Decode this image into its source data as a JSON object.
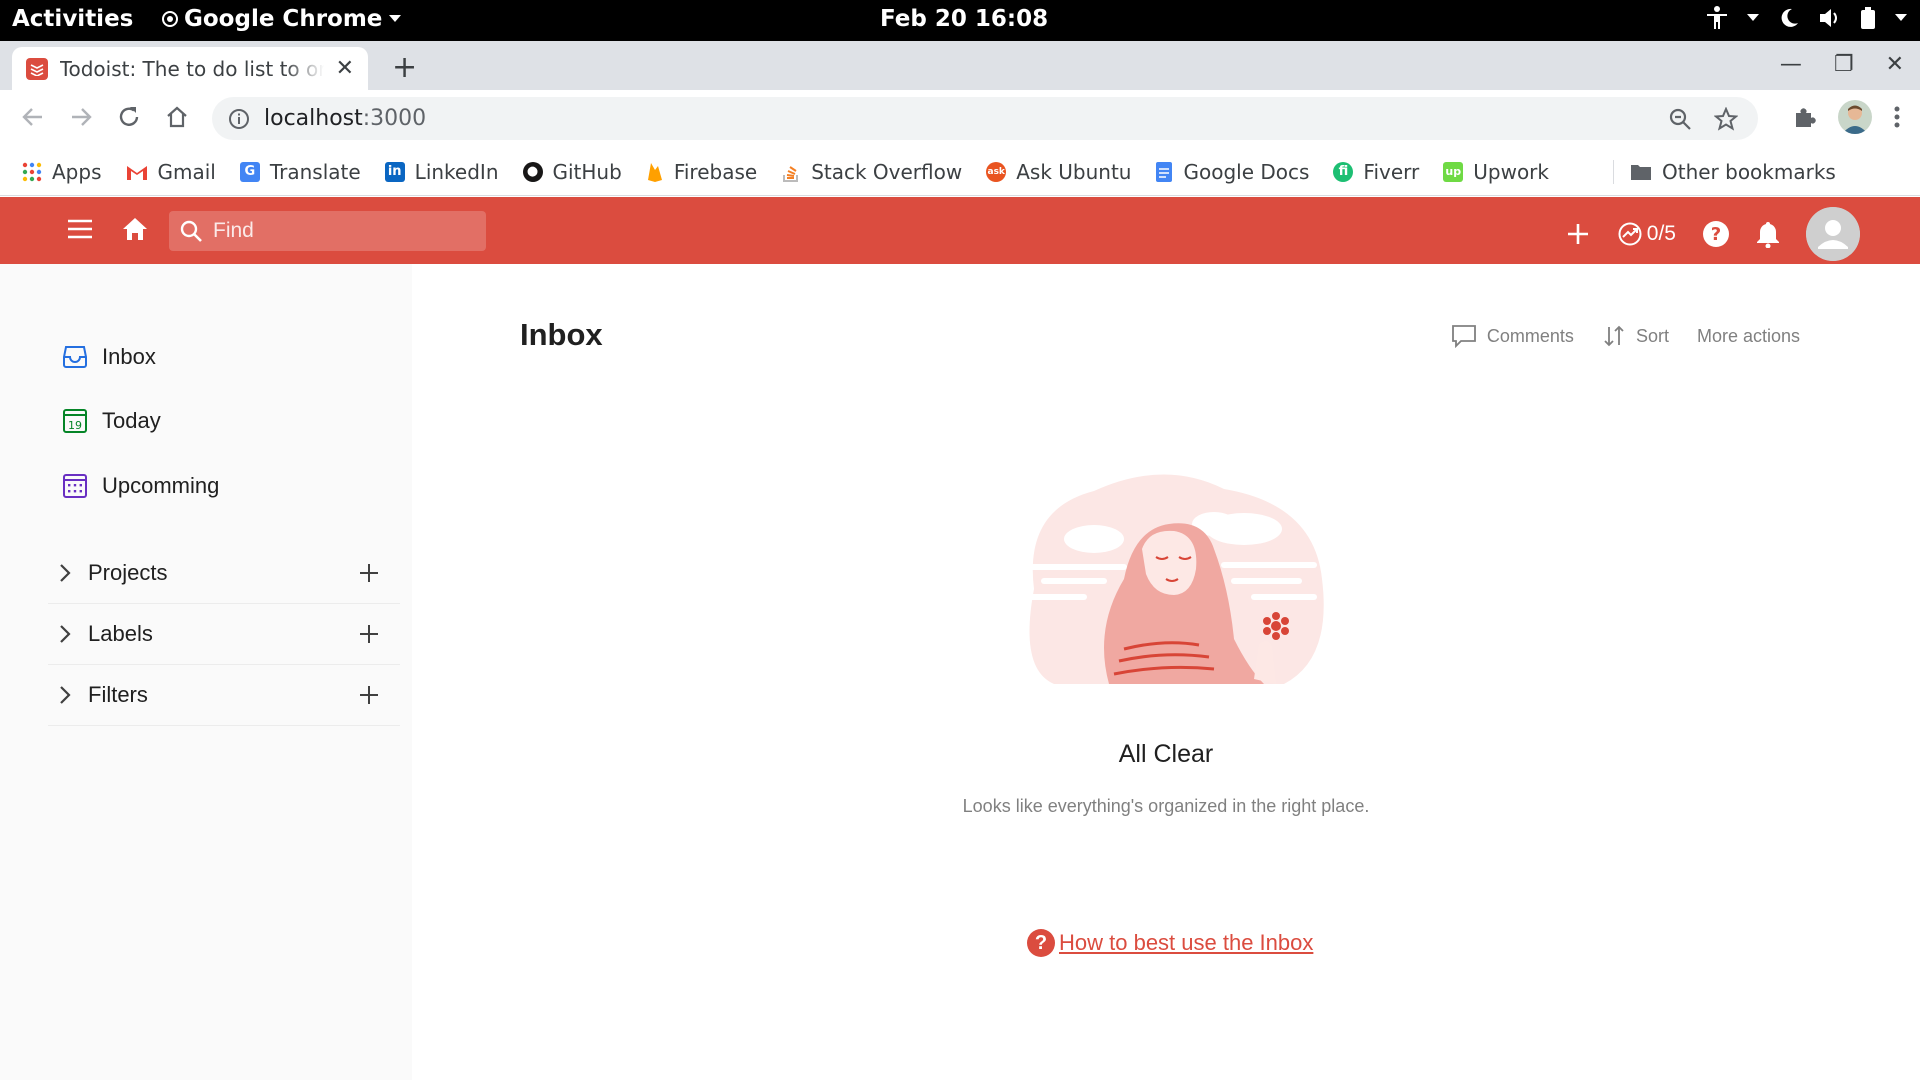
{
  "system_bar": {
    "activities": "Activities",
    "app_name": "Google Chrome",
    "datetime": "Feb 20  16:08"
  },
  "browser": {
    "tab_title": "Todoist: The to do list to organize work & life",
    "url_host": "localhost",
    "url_port": ":3000",
    "bookmarks": [
      {
        "label": "Apps",
        "icon": "apps-grid-icon",
        "color": "#ea4335"
      },
      {
        "label": "Gmail",
        "icon": "gmail-icon",
        "color": "#ea4335"
      },
      {
        "label": "Translate",
        "icon": "translate-icon",
        "color": "#4285f4"
      },
      {
        "label": "LinkedIn",
        "icon": "linkedin-icon",
        "color": "#0a66c2"
      },
      {
        "label": "GitHub",
        "icon": "github-icon",
        "color": "#181717"
      },
      {
        "label": "Firebase",
        "icon": "firebase-icon",
        "color": "#ffa000"
      },
      {
        "label": "Stack Overflow",
        "icon": "stackoverflow-icon",
        "color": "#f48024"
      },
      {
        "label": "Ask Ubuntu",
        "icon": "askubuntu-icon",
        "color": "#e95420"
      },
      {
        "label": "Google Docs",
        "icon": "google-docs-icon",
        "color": "#4285f4"
      },
      {
        "label": "Fiverr",
        "icon": "fiverr-icon",
        "color": "#1dbf73"
      },
      {
        "label": "Upwork",
        "icon": "upwork-icon",
        "color": "#6fda44"
      }
    ],
    "other_bookmarks": "Other bookmarks"
  },
  "header": {
    "search_placeholder": "Find",
    "karma": "0/5",
    "brand_color": "#db4c3f"
  },
  "sidebar": {
    "nav": [
      {
        "label": "Inbox",
        "icon": "inbox-icon",
        "color": "#246fe0"
      },
      {
        "label": "Today",
        "icon": "calendar-today-icon",
        "day": "19",
        "color": "#058527"
      },
      {
        "label": "Upcomming",
        "icon": "calendar-upcoming-icon",
        "color": "#692fc2"
      }
    ],
    "sections": [
      {
        "label": "Projects"
      },
      {
        "label": "Labels"
      },
      {
        "label": "Filters"
      }
    ]
  },
  "main": {
    "title": "Inbox",
    "actions": {
      "comments": "Comments",
      "sort": "Sort",
      "more": "More actions"
    },
    "empty_title": "All Clear",
    "empty_subtitle": "Looks like everything's organized in the right place.",
    "help_link": "How to best use the Inbox"
  }
}
